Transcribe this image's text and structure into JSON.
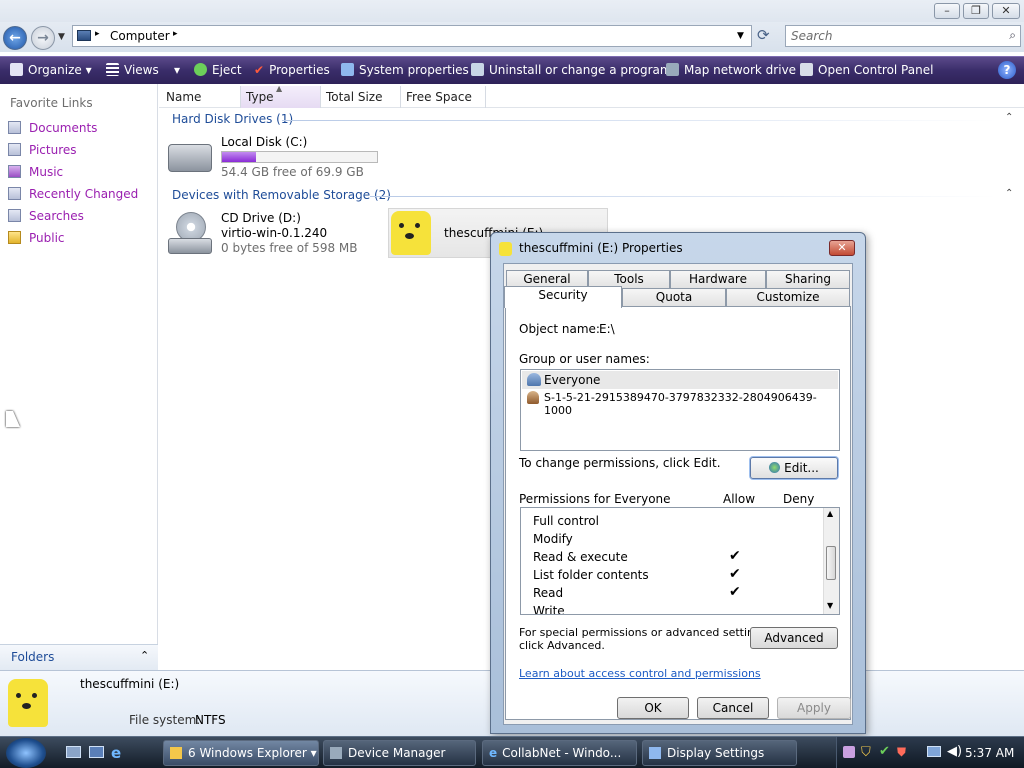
{
  "window": {
    "address": "Computer",
    "search_placeholder": "Search"
  },
  "toolbar": {
    "organize": "Organize",
    "views": "Views",
    "eject": "Eject",
    "properties": "Properties",
    "system_properties": "System properties",
    "uninstall": "Uninstall or change a program",
    "map_drive": "Map network drive",
    "control_panel": "Open Control Panel"
  },
  "sidebar": {
    "heading": "Favorite Links",
    "items": [
      "Documents",
      "Pictures",
      "Music",
      "Recently Changed",
      "Searches",
      "Public"
    ],
    "folders": "Folders"
  },
  "columns": [
    "Name",
    "Type",
    "Total Size",
    "Free Space"
  ],
  "groups": {
    "hdd": "Hard Disk Drives (1)",
    "removable": "Devices with Removable Storage (2)"
  },
  "drives": {
    "local": {
      "name": "Local Disk (C:)",
      "free": "54.4 GB free of 69.9 GB",
      "used_fraction": 0.22
    },
    "cd": {
      "name": "CD Drive (D:)",
      "label": "virtio-win-0.1.240",
      "free": "0 bytes free of 598 MB"
    },
    "usb": {
      "name": "thescuffmini (E:)"
    }
  },
  "details": {
    "name": "thescuffmini (E:)",
    "fs_label": "File system:",
    "fs_value": "NTFS"
  },
  "dialog": {
    "title": "thescuffmini (E:) Properties",
    "tabs_back": [
      "General",
      "Tools",
      "Hardware",
      "Sharing"
    ],
    "tabs_front": [
      "Security",
      "Quota",
      "Customize"
    ],
    "object_label": "Object name:",
    "object_value": "E:\\",
    "group_label": "Group or user names:",
    "users": [
      "Everyone",
      "S-1-5-21-2915389470-3797832332-2804906439-1000"
    ],
    "change_text": "To change permissions, click Edit.",
    "edit_button": "Edit...",
    "perm_header": "Permissions for Everyone",
    "allow": "Allow",
    "deny": "Deny",
    "permissions": [
      {
        "name": "Full control",
        "allow": ""
      },
      {
        "name": "Modify",
        "allow": ""
      },
      {
        "name": "Read & execute",
        "allow": "✔"
      },
      {
        "name": "List folder contents",
        "allow": "✔"
      },
      {
        "name": "Read",
        "allow": "✔"
      },
      {
        "name": "Write",
        "allow": ""
      }
    ],
    "special_text_1": "For special permissions or advanced settings,",
    "special_text_2": "click Advanced.",
    "advanced_button": "Advanced",
    "learn_link": "Learn about access control and permissions",
    "ok": "OK",
    "cancel": "Cancel",
    "apply": "Apply"
  },
  "taskbar": {
    "items": [
      "6 Windows Explorer",
      "Device Manager",
      "CollabNet - Windo...",
      "Display Settings"
    ],
    "clock": "5:37 AM"
  },
  "colors": {
    "toolbar": "#3a2d6a",
    "link": "#9a1fb0",
    "group": "#1e4c98",
    "progress": "#8a2bd6"
  }
}
